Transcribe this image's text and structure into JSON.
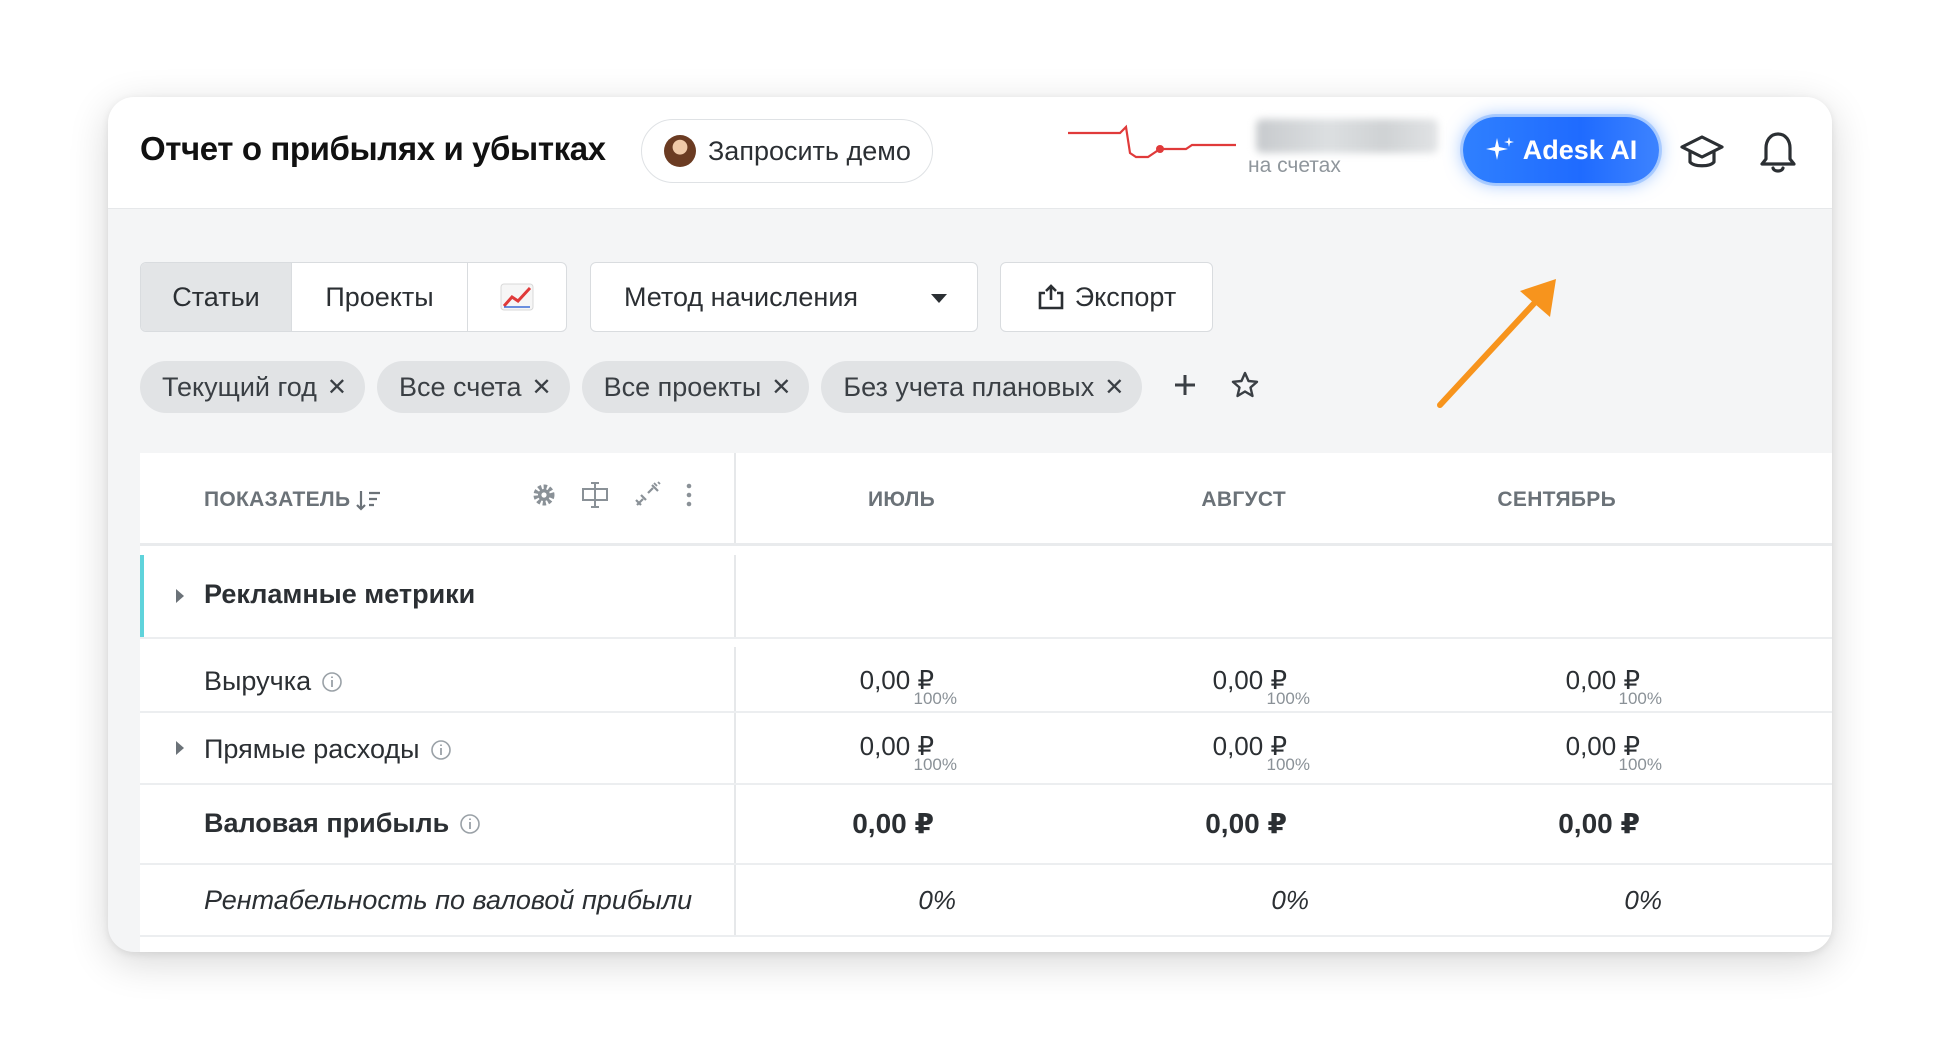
{
  "header": {
    "title": "Отчет о прибылях и убытках",
    "demo_button": "Запросить демо",
    "balance_caption": "на счетах",
    "ai_button": "Adesk AI"
  },
  "toolbar": {
    "tabs": [
      {
        "label": "Статьи",
        "active": true
      },
      {
        "label": "Проекты",
        "active": false
      }
    ],
    "chart_tab_icon": "chart-icon",
    "method_select": "Метод начисления",
    "export_button": "Экспорт"
  },
  "filters": {
    "chips": [
      "Текущий год",
      "Все счета",
      "Все проекты",
      "Без учета плановых"
    ],
    "remove_glyph": "✕"
  },
  "table": {
    "header_label": "ПОКАЗАТЕЛЬ",
    "months": [
      "ИЮЛЬ",
      "АВГУСТ",
      "СЕНТЯБРЬ"
    ],
    "group": "Рекламные метрики",
    "rows": [
      {
        "label": "Выручка",
        "values": [
          "0,00 ₽",
          "0,00 ₽",
          "0,00 ₽"
        ],
        "pct": [
          "100%",
          "100%",
          "100%"
        ]
      },
      {
        "label": "Прямые расходы",
        "values": [
          "0,00 ₽",
          "0,00 ₽",
          "0,00 ₽"
        ],
        "pct": [
          "100%",
          "100%",
          "100%"
        ]
      },
      {
        "label": "Валовая прибыль",
        "values": [
          "0,00 ₽",
          "0,00 ₽",
          "0,00 ₽"
        ]
      },
      {
        "label": "Рентабельность по валовой прибыли",
        "values": [
          "0%",
          "0%",
          "0%"
        ]
      }
    ]
  },
  "colors": {
    "accent_blue": "#2f80ff",
    "sparkline_red": "#e03a3a",
    "arrow_orange": "#f7941d",
    "group_accent": "#5fd3db"
  }
}
